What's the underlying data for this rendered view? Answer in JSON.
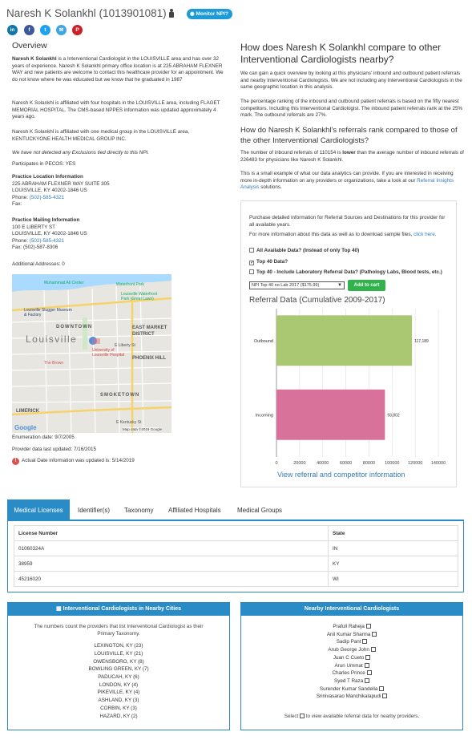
{
  "header": {
    "title": "Naresh K Solankhl (1013901081)",
    "monitor_button": "Monitor NPI?",
    "social_icons": [
      "in",
      "f",
      "t",
      "✉",
      "P"
    ]
  },
  "overview": {
    "heading": "Overview",
    "p1_name": "Naresh K Solankhl",
    "p1_rest": " is a Interventional Cardiologist in the LOUISVILLE area and has over 32 years of experience. Naresh K Solankhl primary office location is at 225 ABRAHAM FLEXNER WAY and new patients are welcome to contact this healthcare provider for an appointment. We do not know where he was educated but we know that he graduated in 1987",
    "p2": "Naresh K Solankhl is affiliated with four hospitals in the LOUISVILLE area, including FLAGET MEMORIAL HOSPITAL. The CMS-based NPPES information was updated approximately 4 years ago.",
    "p3": "Naresh K Solankhl is affiliated with one medical group in the LOUISVILLE area, KENTUCKYONE HEALTH MEDICAL GROUP INC.",
    "p4": "We have not detected any Exclusions tied directly to this NPI.",
    "pecos": "Participates in PECOS: YES",
    "practice_location_heading": "Practice Location Information",
    "practice_location_addr1": "225 ABRAHAM FLEXNER WAY SUITE 305",
    "practice_location_addr2": "LOUISVILLE, KY 40202-1846 US",
    "phone_label": "Phone:",
    "practice_location_phone": "(502)-585-4321",
    "fax_label": "Fax:",
    "mailing_heading": "Practice Mailing Information",
    "mailing_addr1": "100 E LIBERTY ST",
    "mailing_addr2": "LOUISVILLE, KY 40202-1846 US",
    "mailing_phone": "(502)-585-4321",
    "mailing_fax": "(502)-587-8306",
    "additional_addresses": "Additional Addresses: 0"
  },
  "map": {
    "labels": [
      "Muhammad Ali Center",
      "Waterfront Park",
      "Louisville Waterfront Park (Great Lawn)",
      "Louisville Slugger Museum & Factory",
      "DOWNTOWN",
      "EAST MARKET DISTRICT",
      "Louisville",
      "E Liberty St",
      "University of Louisville Hospital",
      "PHOENIX HILL",
      "The Brown",
      "SMOKETOWN",
      "LIMERICK",
      "E Kentucky St"
    ],
    "google": "Google",
    "attribution": "Map data ©2019 Google"
  },
  "dates": {
    "enumeration": "Enumeration date: 9/7/2005",
    "provider_updated": "Provider data last updated: 7/16/2015",
    "actual_updated": "Actual Date information was updated is: 5/14/2019"
  },
  "compare": {
    "heading": "How does Naresh K Solankhl compare to other Interventional Cardiologists nearby?",
    "p1": "We can gain a quick overview by looking at this physicians' inbound and outbound patient referrals and nearby Interventional Cardiologists. We are not including any Interventional Cardiologists in the same geographic location in this analysis.",
    "p2": "The percentage ranking of the inbound and outbound patient referrals is based on the fifty nearest competitors. Including this Interventional Cardiologist. The inbound patient referrals rank at the 25% mark. The outbound referrals are 27%.",
    "heading2": "How do Naresh K Solankhl's referrals rank compared to those of the other Interventional Cardiologists?",
    "p3_a": "The number of inbound referrals of 110154 is ",
    "p3_b": "lower",
    "p3_c": " than the average number of inbound referrals of 226483 for physicians like Naresh K Solankhl.",
    "p4_a": "This is a small example of what our data analytics can provide. If you are interested in receiving more in-depth information on any providers or organizations, take a look at our ",
    "p4_link": "Referral Insights Analysis",
    "p4_b": " solutions."
  },
  "purchase": {
    "p1": "Purchase detailed information for Referral Sources and Destinations for this provider for all available years.",
    "p2_a": "For more information about this data as well as to download sample files, ",
    "p2_link": "click here.",
    "opt1": "All Available Data? (Instead of only Top 40)",
    "opt2": "Top 40 Data?",
    "opt3": "Top 40 - Include Laboratory Referral Data? (Pathology Labs, Blood tests, etc.)",
    "select_value": "NPI Top 40 no Lab 2017 ($175.99)",
    "add_to_cart": "Add to cart"
  },
  "chart_data": {
    "type": "bar",
    "orientation": "horizontal",
    "title": "Referral Data (Cumulative 2009-2017)",
    "categories": [
      "Outbound",
      "Incoming"
    ],
    "values": [
      117189,
      93802
    ],
    "value_labels": [
      "117,189",
      "93,802"
    ],
    "colors": [
      "#a9c871",
      "#d8729a"
    ],
    "xlim": [
      0,
      140000
    ],
    "xticks": [
      "0",
      "20000",
      "40000",
      "60000",
      "80000",
      "100000",
      "120000",
      "140000"
    ],
    "grid": true
  },
  "chart_link": "View referral and competitor information",
  "tabs": [
    "Medical Licenses",
    "Identifier(s)",
    "Taxonomy",
    "Affiliated Hospitals",
    "Medical Groups"
  ],
  "licenses": {
    "headers": [
      "License Number",
      "State"
    ],
    "rows": [
      [
        "01060324A",
        "IN"
      ],
      [
        "38959",
        "KY"
      ],
      [
        "45216020",
        "WI"
      ]
    ]
  },
  "cities": {
    "heading": "Interventional Cardiologists in Nearby Cities",
    "note": "The numbers count the providers that list Interventional Cardiologist as their Primary Taxonomy.",
    "items": [
      "LEXINGTON, KY (23)",
      "LOUISVILLE, KY (21)",
      "OWENSBORO, KY (8)",
      "BOWLING GREEN, KY (7)",
      "PADUCAH, KY (6)",
      "LONDON, KY (4)",
      "PIKEVILLE, KY (4)",
      "ASHLAND, KY (3)",
      "CORBIN, KY (3)",
      "HAZARD, KY (2)"
    ]
  },
  "nearby": {
    "heading": "Nearby Interventional Cardiologists",
    "items": [
      "Prafull Raheja",
      "Anil Kumar Sharma",
      "Sadip Pant",
      "Arub George John",
      "Juan C Cueto",
      "Arun Ummat",
      "Charles Prince",
      "Syed T Raza",
      "Surender Kumar Sandella",
      "Srinivasarao Manchikalapudi"
    ],
    "note_a": "Select ",
    "note_b": " to view available referral data for nearby providers."
  },
  "colors": {
    "accent": "#2a8cc7",
    "link": "#337ab7",
    "button": "#1c9bd8",
    "add_to_cart": "#2fb34a"
  }
}
